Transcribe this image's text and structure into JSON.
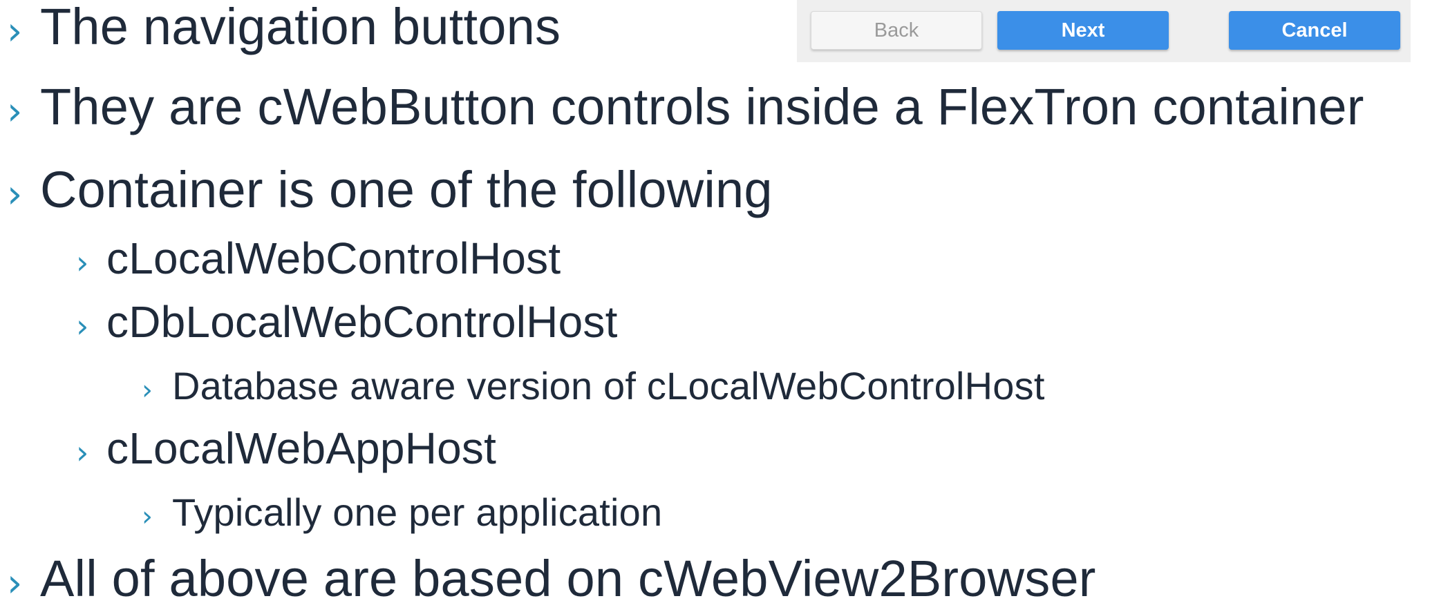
{
  "slide": {
    "bullets": [
      {
        "text": "The navigation buttons"
      },
      {
        "text": "They are cWebButton controls inside a FlexTron container"
      },
      {
        "text": "Container is one of the following"
      },
      {
        "text": "cLocalWebControlHost"
      },
      {
        "text": "cDbLocalWebControlHost"
      },
      {
        "text": "Database aware version of cLocalWebControlHost"
      },
      {
        "text": "cLocalWebAppHost"
      },
      {
        "text": "Typically one per application"
      },
      {
        "text": "All of above are based on cWebView2Browser"
      }
    ],
    "bullet_glyph": "›"
  },
  "nav_buttons": {
    "back_label": "Back",
    "next_label": "Next",
    "cancel_label": "Cancel"
  },
  "colors": {
    "text": "#1f2a3a",
    "bullet_accent": "#2a8fb8",
    "primary_button": "#3b8fe8",
    "disabled_button_bg": "#f6f6f6",
    "strip_bg": "#efefef"
  }
}
